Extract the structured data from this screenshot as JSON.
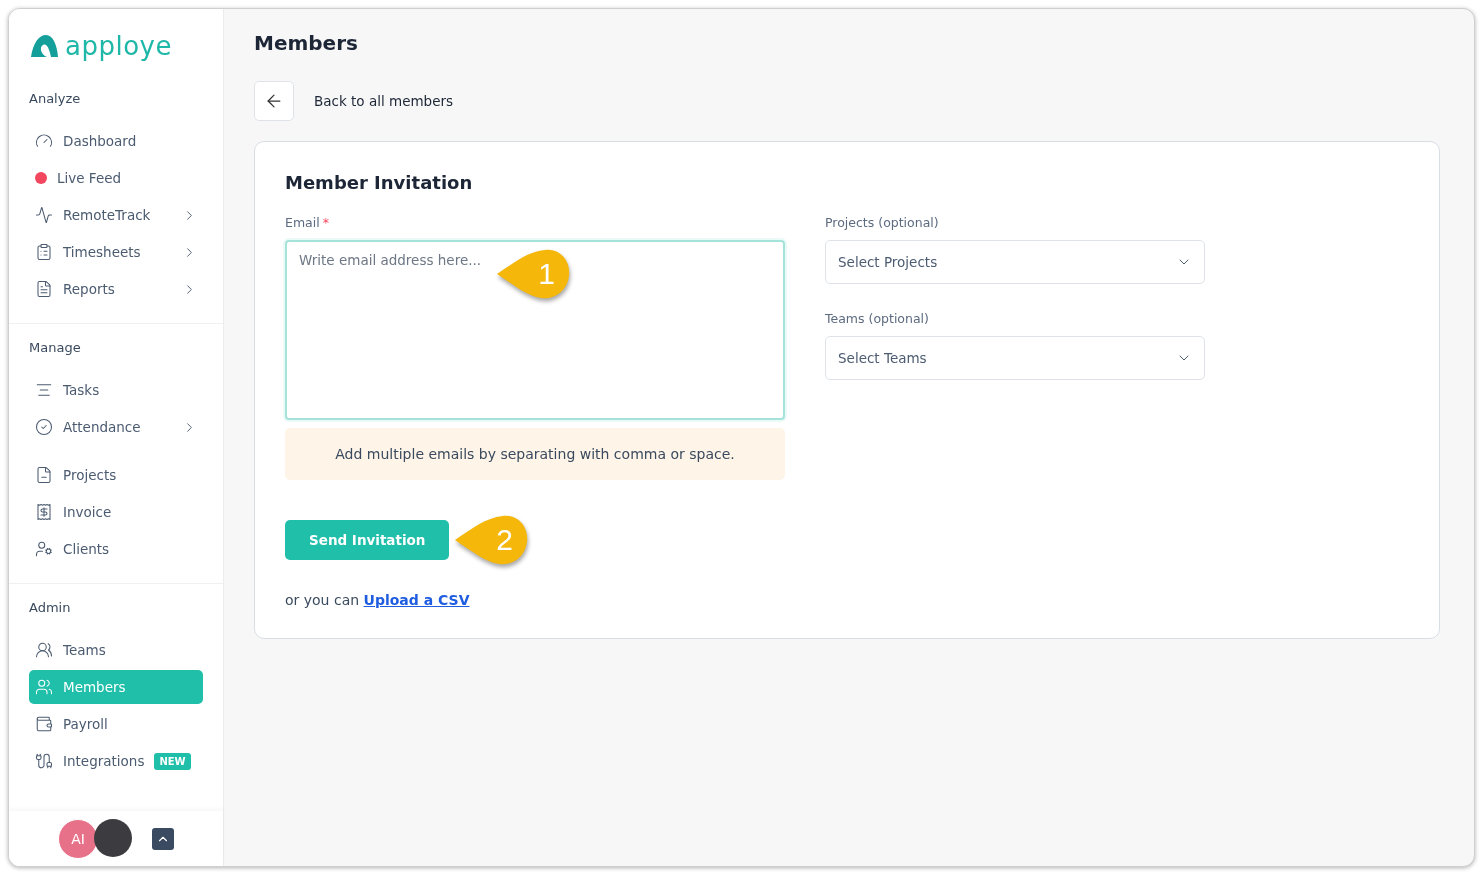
{
  "brand": {
    "name": "apploye"
  },
  "sidebar": {
    "sections": [
      {
        "title": "Analyze",
        "groups": [
          [
            {
              "label": "Dashboard",
              "has_submenu": false,
              "selected": false
            },
            {
              "label": "Live Feed",
              "has_submenu": false,
              "selected": false,
              "color": "#f2475e"
            },
            {
              "label": "RemoteTrack",
              "has_submenu": true,
              "selected": false
            },
            {
              "label": "Timesheets",
              "has_submenu": true,
              "selected": false
            },
            {
              "label": "Reports",
              "has_submenu": true,
              "selected": false
            }
          ]
        ]
      },
      {
        "title": "Manage",
        "groups": [
          [
            {
              "label": "Tasks",
              "has_submenu": false,
              "selected": false
            },
            {
              "label": "Attendance",
              "has_submenu": true,
              "selected": false
            }
          ],
          [
            {
              "label": "Projects",
              "has_submenu": false,
              "selected": false
            },
            {
              "label": "Invoice",
              "has_submenu": false,
              "selected": false
            },
            {
              "label": "Clients",
              "has_submenu": false,
              "selected": false
            }
          ]
        ]
      },
      {
        "title": "Admin",
        "groups": [
          [
            {
              "label": "Teams",
              "has_submenu": false,
              "selected": false
            },
            {
              "label": "Members",
              "has_submenu": false,
              "selected": true
            },
            {
              "label": "Payroll",
              "has_submenu": false,
              "selected": false
            },
            {
              "label": "Integrations",
              "has_submenu": false,
              "selected": false,
              "badge": "NEW"
            }
          ]
        ]
      }
    ]
  },
  "user": {
    "initials": "AI"
  },
  "page": {
    "title": "Members",
    "back_label": "Back to all members"
  },
  "form": {
    "title": "Member Invitation",
    "email": {
      "label": "Email",
      "required_mark": "*",
      "placeholder": "Write email address here..."
    },
    "hint": "Add multiple emails by separating with comma or space.",
    "selects": [
      {
        "label": "Projects (optional)",
        "placeholder": "Select Projects"
      },
      {
        "label": "Teams (optional)",
        "placeholder": "Select Teams"
      }
    ],
    "submit": "Send Invitation",
    "csv_prefix": "or you can",
    "csv_link": "Upload a CSV"
  },
  "callouts": [
    "1",
    "2"
  ]
}
